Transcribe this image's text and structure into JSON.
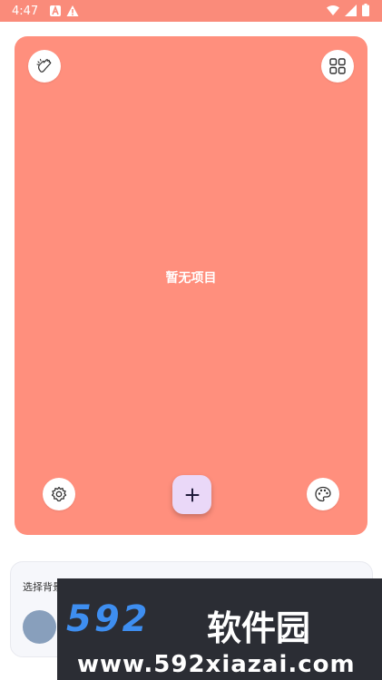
{
  "status_bar": {
    "time": "4:47",
    "icons": [
      "a-icon",
      "warning-icon",
      "wifi-icon",
      "signal-icon",
      "battery-icon"
    ]
  },
  "card": {
    "empty_text": "暂无项目",
    "background_color": "#ff8f7d",
    "buttons": [
      "clap-icon",
      "grid-icon",
      "settings-icon",
      "palette-icon"
    ],
    "fab_label": "+"
  },
  "background_panel": {
    "label": "选择背景",
    "swatch_color": "#889fbc"
  },
  "watermark": {
    "brand": "592",
    "cn": "软件园",
    "url": "www.592xiazai.com"
  }
}
